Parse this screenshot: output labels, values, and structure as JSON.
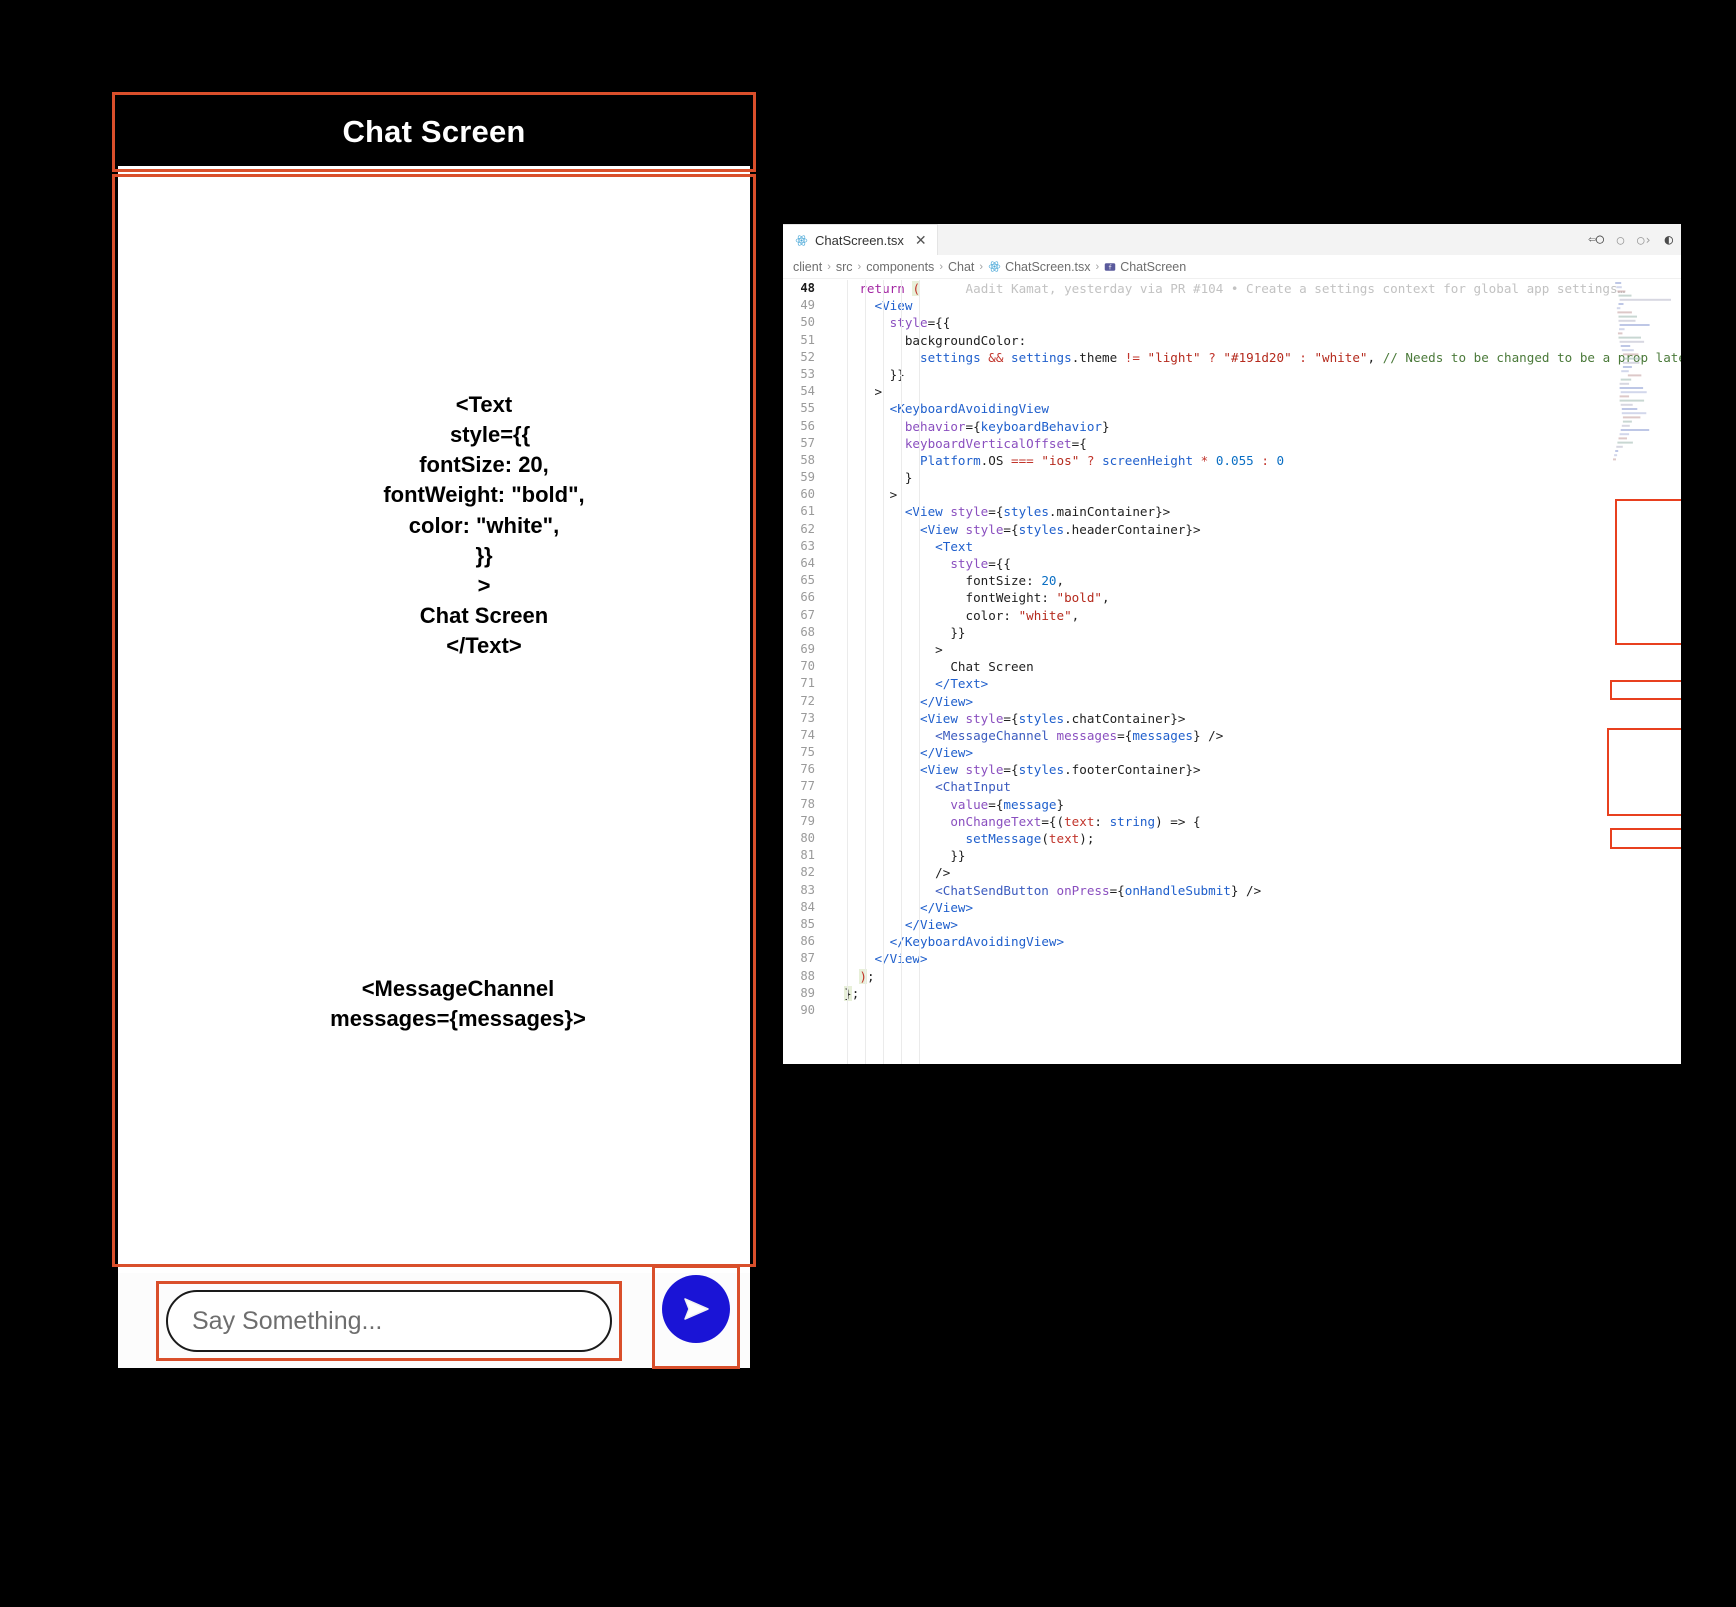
{
  "phone": {
    "header_title": "Chat Screen",
    "annotations": {
      "text_component": "<Text\n  style={{\nfontSize: 20,\nfontWeight: \"bold\",\ncolor: \"white\",\n}}\n>\nChat Screen\n</Text>",
      "message_channel": "<MessageChannel\nmessages={messages}>",
      "chat_input": "<ChatInput>",
      "chat_send_button": "<ChatSendButton>"
    },
    "input_placeholder": "Say Something...",
    "send_icon": "send-paper-plane-icon",
    "accent_color": "#d94f2b",
    "send_button_color": "#1a14d6",
    "header_background": "#000000"
  },
  "editor": {
    "tab": {
      "label": "ChatScreen.tsx",
      "icon": "react-file-icon",
      "close_icon": "close-icon"
    },
    "actions": [
      {
        "name": "go-back-icon",
        "glyph": "⇦"
      },
      {
        "name": "split-left-icon",
        "glyph": "○"
      },
      {
        "name": "split-right-icon",
        "glyph": "○"
      },
      {
        "name": "more-actions-icon",
        "glyph": "ⓘ"
      }
    ],
    "breadcrumb": [
      "client",
      "src",
      "components",
      "Chat",
      "ChatScreen.tsx",
      "ChatScreen"
    ],
    "breadcrumb_separator": "›",
    "inline_blame": "Aadit Kamat, yesterday via PR #104 • Create a settings context for global app settings…",
    "first_line_number": 48,
    "last_line_number": 90,
    "highlight_color": "#e8401f",
    "lines": [
      {
        "n": 48,
        "current": true,
        "tokens": [
          {
            "t": "    ",
            "c": "t-punct"
          },
          {
            "t": "return",
            "c": "t-kw"
          },
          {
            "t": " ",
            "c": "t-punct"
          },
          {
            "t": "(",
            "c": "t-paren t-op"
          }
        ],
        "ghost": "      Aadit Kamat, yesterday via PR #104 • Create a settings context for global app settings…"
      },
      {
        "n": 49,
        "tokens": [
          {
            "t": "      ",
            "c": "t-punct"
          },
          {
            "t": "<View",
            "c": "t-tag"
          }
        ]
      },
      {
        "n": 50,
        "tokens": [
          {
            "t": "        ",
            "c": "t-punct"
          },
          {
            "t": "style",
            "c": "t-attr"
          },
          {
            "t": "={{",
            "c": "t-punct"
          }
        ]
      },
      {
        "n": 51,
        "tokens": [
          {
            "t": "          ",
            "c": "t-punct"
          },
          {
            "t": "backgroundColor",
            "c": "t-prop"
          },
          {
            "t": ":",
            "c": "t-punct"
          }
        ]
      },
      {
        "n": 52,
        "tokens": [
          {
            "t": "            ",
            "c": "t-punct"
          },
          {
            "t": "settings",
            "c": "t-var"
          },
          {
            "t": " ",
            "c": "t-punct"
          },
          {
            "t": "&&",
            "c": "t-op"
          },
          {
            "t": " ",
            "c": "t-punct"
          },
          {
            "t": "settings",
            "c": "t-var"
          },
          {
            "t": ".theme ",
            "c": "t-punct"
          },
          {
            "t": "!=",
            "c": "t-op"
          },
          {
            "t": " ",
            "c": "t-punct"
          },
          {
            "t": "\"light\"",
            "c": "t-str"
          },
          {
            "t": " ",
            "c": "t-punct"
          },
          {
            "t": "?",
            "c": "t-op"
          },
          {
            "t": " ",
            "c": "t-punct"
          },
          {
            "t": "\"#191d20\"",
            "c": "t-str"
          },
          {
            "t": " ",
            "c": "t-punct"
          },
          {
            "t": ":",
            "c": "t-op"
          },
          {
            "t": " ",
            "c": "t-punct"
          },
          {
            "t": "\"white\"",
            "c": "t-str"
          },
          {
            "t": ", ",
            "c": "t-punct"
          },
          {
            "t": "// Needs to be changed to be a prop later",
            "c": "t-comment"
          }
        ]
      },
      {
        "n": 53,
        "tokens": [
          {
            "t": "        }}",
            "c": "t-punct"
          }
        ]
      },
      {
        "n": 54,
        "tokens": [
          {
            "t": "      >",
            "c": "t-punct"
          }
        ]
      },
      {
        "n": 55,
        "tokens": [
          {
            "t": "        ",
            "c": "t-punct"
          },
          {
            "t": "<KeyboardAvoidingView",
            "c": "t-tag"
          }
        ]
      },
      {
        "n": 56,
        "tokens": [
          {
            "t": "          ",
            "c": "t-punct"
          },
          {
            "t": "behavior",
            "c": "t-attr"
          },
          {
            "t": "={",
            "c": "t-punct"
          },
          {
            "t": "keyboardBehavior",
            "c": "t-var"
          },
          {
            "t": "}",
            "c": "t-punct"
          }
        ]
      },
      {
        "n": 57,
        "tokens": [
          {
            "t": "          ",
            "c": "t-punct"
          },
          {
            "t": "keyboardVerticalOffset",
            "c": "t-attr"
          },
          {
            "t": "={",
            "c": "t-punct"
          }
        ]
      },
      {
        "n": 58,
        "tokens": [
          {
            "t": "            ",
            "c": "t-punct"
          },
          {
            "t": "Platform",
            "c": "t-var"
          },
          {
            "t": ".OS ",
            "c": "t-punct"
          },
          {
            "t": "===",
            "c": "t-op"
          },
          {
            "t": " ",
            "c": "t-punct"
          },
          {
            "t": "\"ios\"",
            "c": "t-str"
          },
          {
            "t": " ",
            "c": "t-punct"
          },
          {
            "t": "?",
            "c": "t-op"
          },
          {
            "t": " ",
            "c": "t-punct"
          },
          {
            "t": "screenHeight",
            "c": "t-var"
          },
          {
            "t": " ",
            "c": "t-punct"
          },
          {
            "t": "*",
            "c": "t-op"
          },
          {
            "t": " ",
            "c": "t-punct"
          },
          {
            "t": "0.055",
            "c": "t-num"
          },
          {
            "t": " ",
            "c": "t-punct"
          },
          {
            "t": ":",
            "c": "t-op"
          },
          {
            "t": " ",
            "c": "t-punct"
          },
          {
            "t": "0",
            "c": "t-num"
          }
        ]
      },
      {
        "n": 59,
        "tokens": [
          {
            "t": "          }",
            "c": "t-punct"
          }
        ]
      },
      {
        "n": 60,
        "tokens": [
          {
            "t": "        >",
            "c": "t-punct"
          }
        ]
      },
      {
        "n": 61,
        "tokens": [
          {
            "t": "          ",
            "c": "t-punct"
          },
          {
            "t": "<View ",
            "c": "t-tag"
          },
          {
            "t": "style",
            "c": "t-attr"
          },
          {
            "t": "={",
            "c": "t-punct"
          },
          {
            "t": "styles",
            "c": "t-var"
          },
          {
            "t": ".mainContainer",
            "c": "t-punct"
          },
          {
            "t": "}>",
            "c": "t-punct"
          }
        ]
      },
      {
        "n": 62,
        "tokens": [
          {
            "t": "            ",
            "c": "t-punct"
          },
          {
            "t": "<View ",
            "c": "t-tag"
          },
          {
            "t": "style",
            "c": "t-attr"
          },
          {
            "t": "={",
            "c": "t-punct"
          },
          {
            "t": "styles",
            "c": "t-var"
          },
          {
            "t": ".headerContainer",
            "c": "t-punct"
          },
          {
            "t": "}>",
            "c": "t-punct"
          }
        ]
      },
      {
        "n": 63,
        "tokens": [
          {
            "t": "              ",
            "c": "t-punct"
          },
          {
            "t": "<Text",
            "c": "t-tag"
          }
        ]
      },
      {
        "n": 64,
        "tokens": [
          {
            "t": "                ",
            "c": "t-punct"
          },
          {
            "t": "style",
            "c": "t-attr"
          },
          {
            "t": "={{",
            "c": "t-punct"
          }
        ]
      },
      {
        "n": 65,
        "tokens": [
          {
            "t": "                  ",
            "c": "t-punct"
          },
          {
            "t": "fontSize",
            "c": "t-prop"
          },
          {
            "t": ": ",
            "c": "t-punct"
          },
          {
            "t": "20",
            "c": "t-num"
          },
          {
            "t": ",",
            "c": "t-punct"
          }
        ]
      },
      {
        "n": 66,
        "tokens": [
          {
            "t": "                  ",
            "c": "t-punct"
          },
          {
            "t": "fontWeight",
            "c": "t-prop"
          },
          {
            "t": ": ",
            "c": "t-punct"
          },
          {
            "t": "\"bold\"",
            "c": "t-str"
          },
          {
            "t": ",",
            "c": "t-punct"
          }
        ]
      },
      {
        "n": 67,
        "tokens": [
          {
            "t": "                  ",
            "c": "t-punct"
          },
          {
            "t": "color",
            "c": "t-prop"
          },
          {
            "t": ": ",
            "c": "t-punct"
          },
          {
            "t": "\"white\"",
            "c": "t-str"
          },
          {
            "t": ",",
            "c": "t-punct"
          }
        ]
      },
      {
        "n": 68,
        "tokens": [
          {
            "t": "                }}",
            "c": "t-punct"
          }
        ]
      },
      {
        "n": 69,
        "tokens": [
          {
            "t": "              >",
            "c": "t-punct"
          }
        ]
      },
      {
        "n": 70,
        "tokens": [
          {
            "t": "                Chat Screen",
            "c": "t-punct"
          }
        ]
      },
      {
        "n": 71,
        "tokens": [
          {
            "t": "              ",
            "c": "t-punct"
          },
          {
            "t": "</Text>",
            "c": "t-tag"
          }
        ]
      },
      {
        "n": 72,
        "tokens": [
          {
            "t": "            ",
            "c": "t-punct"
          },
          {
            "t": "</View>",
            "c": "t-tag"
          }
        ]
      },
      {
        "n": 73,
        "tokens": [
          {
            "t": "            ",
            "c": "t-punct"
          },
          {
            "t": "<View ",
            "c": "t-tag"
          },
          {
            "t": "style",
            "c": "t-attr"
          },
          {
            "t": "={",
            "c": "t-punct"
          },
          {
            "t": "styles",
            "c": "t-var"
          },
          {
            "t": ".chatContainer",
            "c": "t-punct"
          },
          {
            "t": "}>",
            "c": "t-punct"
          }
        ]
      },
      {
        "n": 74,
        "tokens": [
          {
            "t": "              ",
            "c": "t-punct"
          },
          {
            "t": "<MessageChannel ",
            "c": "t-tag2"
          },
          {
            "t": "messages",
            "c": "t-attr"
          },
          {
            "t": "={",
            "c": "t-punct"
          },
          {
            "t": "messages",
            "c": "t-var"
          },
          {
            "t": "} />",
            "c": "t-punct"
          }
        ]
      },
      {
        "n": 75,
        "tokens": [
          {
            "t": "            ",
            "c": "t-punct"
          },
          {
            "t": "</View>",
            "c": "t-tag"
          }
        ]
      },
      {
        "n": 76,
        "tokens": [
          {
            "t": "            ",
            "c": "t-punct"
          },
          {
            "t": "<View ",
            "c": "t-tag"
          },
          {
            "t": "style",
            "c": "t-attr"
          },
          {
            "t": "={",
            "c": "t-punct"
          },
          {
            "t": "styles",
            "c": "t-var"
          },
          {
            "t": ".footerContainer",
            "c": "t-punct"
          },
          {
            "t": "}>",
            "c": "t-punct"
          }
        ]
      },
      {
        "n": 77,
        "tokens": [
          {
            "t": "              ",
            "c": "t-punct"
          },
          {
            "t": "<ChatInput",
            "c": "t-tag2"
          }
        ]
      },
      {
        "n": 78,
        "tokens": [
          {
            "t": "                ",
            "c": "t-punct"
          },
          {
            "t": "value",
            "c": "t-attr"
          },
          {
            "t": "={",
            "c": "t-punct"
          },
          {
            "t": "message",
            "c": "t-var"
          },
          {
            "t": "}",
            "c": "t-punct"
          }
        ]
      },
      {
        "n": 79,
        "tokens": [
          {
            "t": "                ",
            "c": "t-punct"
          },
          {
            "t": "onChangeText",
            "c": "t-attr"
          },
          {
            "t": "={(",
            "c": "t-punct"
          },
          {
            "t": "text",
            "c": "t-op"
          },
          {
            "t": ": ",
            "c": "t-punct"
          },
          {
            "t": "string",
            "c": "t-tag"
          },
          {
            "t": ") => {",
            "c": "t-punct"
          }
        ]
      },
      {
        "n": 80,
        "tokens": [
          {
            "t": "                  ",
            "c": "t-punct"
          },
          {
            "t": "setMessage",
            "c": "t-var"
          },
          {
            "t": "(",
            "c": "t-punct"
          },
          {
            "t": "text",
            "c": "t-op"
          },
          {
            "t": ");",
            "c": "t-punct"
          }
        ]
      },
      {
        "n": 81,
        "tokens": [
          {
            "t": "                }}",
            "c": "t-punct"
          }
        ]
      },
      {
        "n": 82,
        "tokens": [
          {
            "t": "              />",
            "c": "t-punct"
          }
        ]
      },
      {
        "n": 83,
        "tokens": [
          {
            "t": "              ",
            "c": "t-punct"
          },
          {
            "t": "<ChatSendButton ",
            "c": "t-tag2"
          },
          {
            "t": "onPress",
            "c": "t-attr"
          },
          {
            "t": "={",
            "c": "t-punct"
          },
          {
            "t": "onHandleSubmit",
            "c": "t-var"
          },
          {
            "t": "} />",
            "c": "t-punct"
          }
        ]
      },
      {
        "n": 84,
        "tokens": [
          {
            "t": "            ",
            "c": "t-punct"
          },
          {
            "t": "</View>",
            "c": "t-tag"
          }
        ]
      },
      {
        "n": 85,
        "tokens": [
          {
            "t": "          ",
            "c": "t-punct"
          },
          {
            "t": "</View>",
            "c": "t-tag"
          }
        ]
      },
      {
        "n": 86,
        "tokens": [
          {
            "t": "        ",
            "c": "t-punct"
          },
          {
            "t": "</KeyboardAvoidingView>",
            "c": "t-tag"
          }
        ]
      },
      {
        "n": 87,
        "tokens": [
          {
            "t": "      ",
            "c": "t-punct"
          },
          {
            "t": "</View>",
            "c": "t-tag"
          }
        ]
      },
      {
        "n": 88,
        "tokens": [
          {
            "t": "    ",
            "c": "t-punct"
          },
          {
            "t": ")",
            "c": "t-paren t-op"
          },
          {
            "t": ";",
            "c": "t-punct"
          }
        ]
      },
      {
        "n": 89,
        "tokens": [
          {
            "t": "  ",
            "c": "t-punct"
          },
          {
            "t": "}",
            "c": "t-paren t-punct"
          },
          {
            "t": ";",
            "c": "t-punct"
          }
        ]
      },
      {
        "n": 90,
        "tokens": [
          {
            "t": "",
            "c": "t-punct"
          }
        ]
      }
    ]
  }
}
